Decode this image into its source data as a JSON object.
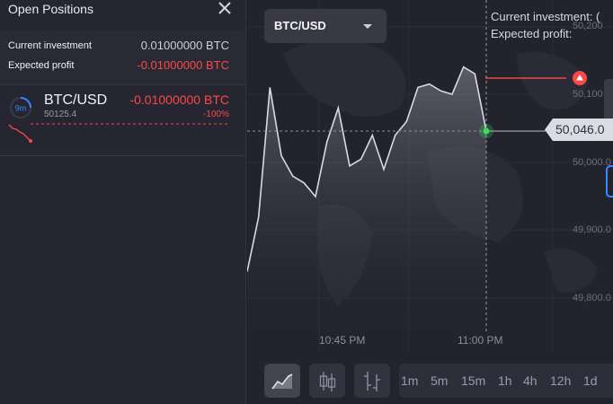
{
  "panel": {
    "title": "Open Positions",
    "current_investment_label": "Current investment",
    "current_investment_value": "0.01000000 BTC",
    "expected_profit_label": "Expected profit",
    "expected_profit_value": "-0.01000000 BTC"
  },
  "position": {
    "timer": "9m",
    "pair": "BTC/USD",
    "price": "50125.4",
    "profit": "-0.01000000 BTC",
    "percent": "-100%"
  },
  "chart": {
    "pair_selector": "BTC/USD",
    "info_investment": "Current investment: (",
    "info_profit": "Expected profit:",
    "current_price": "50,046.0",
    "y_ticks": [
      "50,200",
      "50,100",
      "50,000.0",
      "49,900.0",
      "49,800.0"
    ],
    "x_ticks": [
      "10:45 PM",
      "11:00 PM"
    ],
    "colors": {
      "loss": "#ff4747",
      "up": "#3ddc5a",
      "accent": "#2f8cff"
    }
  },
  "toolbar": {
    "chart_types": [
      "area-chart-icon",
      "candlestick-icon",
      "bar-chart-icon"
    ],
    "timeframes": [
      "1m",
      "5m",
      "15m",
      "1h",
      "4h",
      "12h",
      "1d"
    ]
  },
  "chart_data": {
    "type": "area",
    "x_range": [
      "10:38 PM",
      "11:01 PM"
    ],
    "ylim": [
      49760,
      50220
    ],
    "values": [
      49840,
      49920,
      50110,
      50010,
      49980,
      49970,
      49950,
      50030,
      50080,
      49995,
      50005,
      50040,
      49990,
      50040,
      50060,
      50110,
      50115,
      50105,
      50100,
      50140,
      50130,
      50046
    ]
  }
}
